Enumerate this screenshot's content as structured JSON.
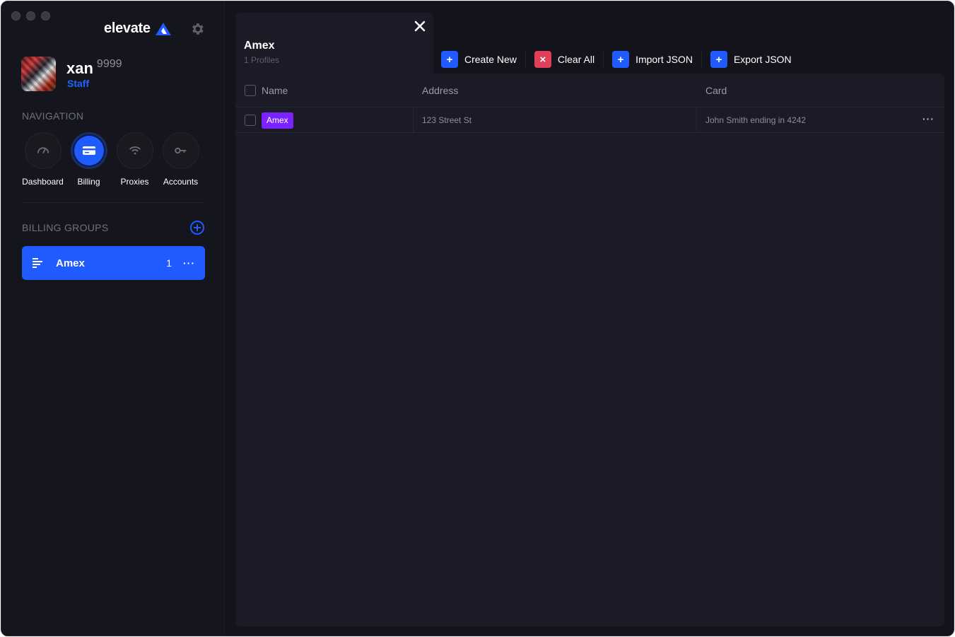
{
  "app": {
    "brand": "elevate"
  },
  "user": {
    "name": "xan",
    "discriminator": "9999",
    "role": "Staff"
  },
  "sidebar": {
    "navigation_label": "NAVIGATION",
    "nav": [
      {
        "label": "Dashboard",
        "icon": "speedometer-icon",
        "active": false
      },
      {
        "label": "Billing",
        "icon": "credit-card-icon",
        "active": true
      },
      {
        "label": "Proxies",
        "icon": "wifi-icon",
        "active": false
      },
      {
        "label": "Accounts",
        "icon": "key-icon",
        "active": false
      }
    ],
    "billing_groups_label": "BILLING GROUPS",
    "groups": [
      {
        "name": "Amex",
        "count": "1",
        "more": "···"
      }
    ]
  },
  "tab": {
    "title": "Amex",
    "subtitle": "1 Profiles"
  },
  "toolbar": {
    "create_new": "Create New",
    "clear_all": "Clear All",
    "import_json": "Import JSON",
    "export_json": "Export JSON"
  },
  "table": {
    "columns": [
      "Name",
      "Address",
      "Card"
    ],
    "rows": [
      {
        "name": "Amex",
        "address": "123 Street St",
        "card": "John Smith ending in 4242",
        "more": "···"
      }
    ]
  },
  "colors": {
    "accent": "#1f5bff",
    "danger": "#e0405a",
    "tag": "#7a22ff",
    "background": "#13131b",
    "panel": "#1b1b27"
  }
}
